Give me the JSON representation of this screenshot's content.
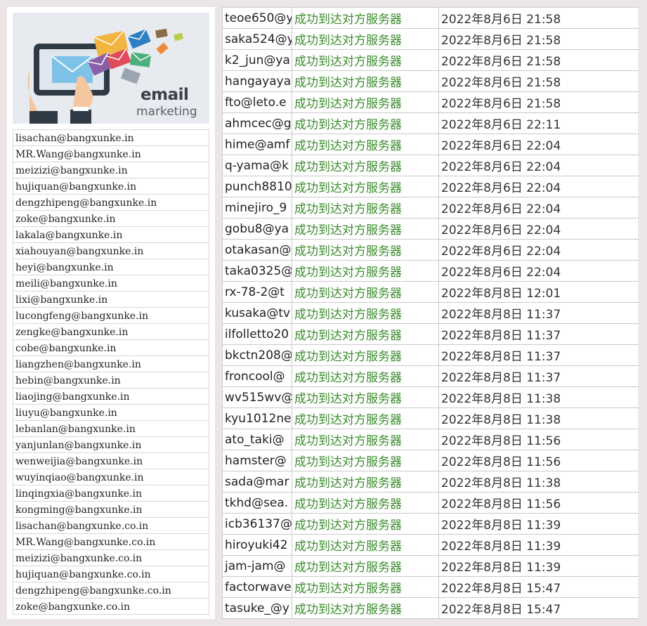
{
  "banner": {
    "title": "email",
    "subtitle": "marketing"
  },
  "colors": {
    "status_green": "#3a8c2c",
    "background": "#ebe6e5"
  },
  "email_list": [
    "lisachan@bangxunke.in",
    "MR.Wang@bangxunke.in",
    "meizizi@bangxunke.in",
    "hujiquan@bangxunke.in",
    "dengzhipeng@bangxunke.in",
    "zoke@bangxunke.in",
    "lakala@bangxunke.in",
    "xiahouyan@bangxunke.in",
    "heyi@bangxunke.in",
    "meili@bangxunke.in",
    "lixi@bangxunke.in",
    "lucongfeng@bangxunke.in",
    "zengke@bangxunke.in",
    "cobe@bangxunke.in",
    "liangzhen@bangxunke.in",
    "hebin@bangxunke.in",
    "liaojing@bangxunke.in",
    "liuyu@bangxunke.in",
    "lebanlan@bangxunke.in",
    "yanjunlan@bangxunke.in",
    "wenweijia@bangxunke.in",
    "wuyinqiao@bangxunke.in",
    "linqingxia@bangxunke.in",
    "kongming@bangxunke.in",
    "lisachan@bangxunke.co.in",
    "MR.Wang@bangxunke.co.in",
    "meizizi@bangxunke.co.in",
    "hujiquan@bangxunke.co.in",
    "dengzhipeng@bangxunke.co.in",
    "zoke@bangxunke.co.in"
  ],
  "delivery_log": [
    {
      "email": "teoe650@y",
      "status": "成功到达对方服务器",
      "time": "2022年8月6日 21:58"
    },
    {
      "email": "saka524@y",
      "status": "成功到达对方服务器",
      "time": "2022年8月6日 21:58"
    },
    {
      "email": "k2_jun@ya",
      "status": "成功到达对方服务器",
      "time": "2022年8月6日 21:58"
    },
    {
      "email": "hangayaya",
      "status": "成功到达对方服务器",
      "time": "2022年8月6日 21:58"
    },
    {
      "email": "fto@leto.e",
      "status": "成功到达对方服务器",
      "time": "2022年8月6日 21:58"
    },
    {
      "email": "ahmcec@g",
      "status": "成功到达对方服务器",
      "time": "2022年8月6日 22:11"
    },
    {
      "email": "hime@amf",
      "status": "成功到达对方服务器",
      "time": "2022年8月6日 22:04"
    },
    {
      "email": "q-yama@k",
      "status": "成功到达对方服务器",
      "time": "2022年8月6日 22:04"
    },
    {
      "email": "punch8810",
      "status": "成功到达对方服务器",
      "time": "2022年8月6日 22:04"
    },
    {
      "email": "minejiro_9",
      "status": "成功到达对方服务器",
      "time": "2022年8月6日 22:04"
    },
    {
      "email": "gobu8@ya",
      "status": "成功到达对方服务器",
      "time": "2022年8月6日 22:04"
    },
    {
      "email": "otakasan@",
      "status": "成功到达对方服务器",
      "time": "2022年8月6日 22:04"
    },
    {
      "email": "taka0325@",
      "status": "成功到达对方服务器",
      "time": "2022年8月6日 22:04"
    },
    {
      "email": "rx-78-2@t",
      "status": "成功到达对方服务器",
      "time": "2022年8月8日 12:01"
    },
    {
      "email": "kusaka@tv",
      "status": "成功到达对方服务器",
      "time": "2022年8月8日 11:37"
    },
    {
      "email": "ilfolletto20",
      "status": "成功到达对方服务器",
      "time": "2022年8月8日 11:37"
    },
    {
      "email": "bkctn208@",
      "status": "成功到达对方服务器",
      "time": "2022年8月8日 11:37"
    },
    {
      "email": "froncool@",
      "status": "成功到达对方服务器",
      "time": "2022年8月8日 11:37"
    },
    {
      "email": "wv515wv@",
      "status": "成功到达对方服务器",
      "time": "2022年8月8日 11:38"
    },
    {
      "email": "kyu1012ne",
      "status": "成功到达对方服务器",
      "time": "2022年8月8日 11:38"
    },
    {
      "email": "ato_taki@",
      "status": "成功到达对方服务器",
      "time": "2022年8月8日 11:56"
    },
    {
      "email": "hamster@",
      "status": "成功到达对方服务器",
      "time": "2022年8月8日 11:56"
    },
    {
      "email": "sada@mar",
      "status": "成功到达对方服务器",
      "time": "2022年8月8日 11:38"
    },
    {
      "email": "tkhd@sea.",
      "status": "成功到达对方服务器",
      "time": "2022年8月8日 11:56"
    },
    {
      "email": "icb36137@",
      "status": "成功到达对方服务器",
      "time": "2022年8月8日 11:39"
    },
    {
      "email": "hiroyuki42",
      "status": "成功到达对方服务器",
      "time": "2022年8月8日 11:39"
    },
    {
      "email": "jam-jam@",
      "status": "成功到达对方服务器",
      "time": "2022年8月8日 11:39"
    },
    {
      "email": "factorwave",
      "status": "成功到达对方服务器",
      "time": "2022年8月8日 15:47"
    },
    {
      "email": "tasuke_@y",
      "status": "成功到达对方服务器",
      "time": "2022年8月8日 15:47"
    }
  ]
}
